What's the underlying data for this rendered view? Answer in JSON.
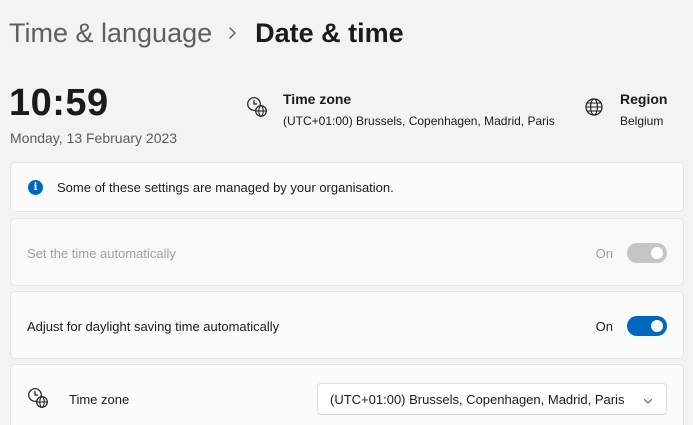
{
  "breadcrumb": {
    "parent": "Time & language",
    "current": "Date & time"
  },
  "clock": {
    "time": "10:59",
    "date": "Monday, 13 February 2023"
  },
  "time_zone_summary": {
    "title": "Time zone",
    "value": "(UTC+01:00) Brussels, Copenhagen, Madrid, Paris",
    "icon": "clock-globe-icon"
  },
  "region_summary": {
    "title": "Region",
    "value": "Belgium",
    "icon": "globe-icon"
  },
  "info": {
    "text": "Some of these settings are managed by your organisation.",
    "icon": "info-icon",
    "icon_glyph": "i"
  },
  "settings": {
    "auto_time": {
      "label": "Set the time automatically",
      "state_text": "On",
      "enabled": false
    },
    "daylight_saving": {
      "label": "Adjust for daylight saving time automatically",
      "state_text": "On",
      "enabled": true
    },
    "time_zone": {
      "label": "Time zone",
      "selected": "(UTC+01:00) Brussels, Copenhagen, Madrid, Paris"
    }
  },
  "colors": {
    "accent": "#0067c0",
    "disabled": "#c5c5c5",
    "background": "#f3f3f3"
  }
}
